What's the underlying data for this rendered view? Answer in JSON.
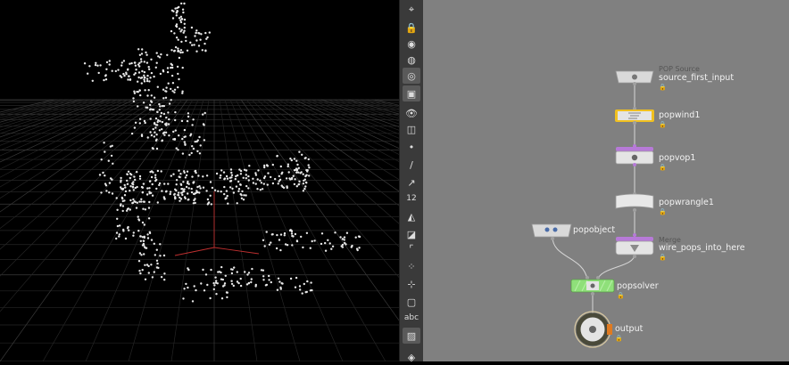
{
  "toolbar": {
    "tools": [
      {
        "name": "select-icon",
        "glyph": "⌖"
      },
      {
        "name": "lock-icon",
        "glyph": "🔒"
      },
      {
        "name": "camera-icon",
        "glyph": "◉"
      },
      {
        "name": "sphere-icon",
        "glyph": "◍"
      },
      {
        "name": "light-icon",
        "glyph": "◎"
      },
      {
        "name": "render-icon",
        "glyph": "▣"
      },
      {
        "name": "visibility-icon",
        "glyph": "👁"
      },
      {
        "name": "display-icon",
        "glyph": "◫"
      },
      {
        "name": "point-icon",
        "glyph": "•"
      },
      {
        "name": "edge-icon",
        "glyph": "/"
      },
      {
        "name": "vector-icon",
        "glyph": "↗"
      },
      {
        "name": "numbers-icon",
        "glyph": "12"
      },
      {
        "name": "paint-icon",
        "glyph": "◭"
      },
      {
        "name": "shaded-icon",
        "glyph": "◪"
      },
      {
        "name": "corner-icon",
        "glyph": "⌜"
      },
      {
        "name": "grid-points-icon",
        "glyph": "⁘"
      },
      {
        "name": "scatter-icon",
        "glyph": "⊹"
      },
      {
        "name": "box-icon",
        "glyph": "▢"
      },
      {
        "name": "text-icon",
        "glyph": "abc"
      },
      {
        "name": "image-icon",
        "glyph": "▨"
      },
      {
        "name": "pin-icon",
        "glyph": "◈"
      }
    ]
  },
  "network": {
    "nodes": {
      "source": {
        "type": "POP Source",
        "name": "source_first_input"
      },
      "popwind": {
        "name": "popwind1"
      },
      "popvop": {
        "name": "popvop1"
      },
      "popwrangle": {
        "name": "popwrangle1"
      },
      "merge": {
        "type": "Merge",
        "name": "wire_pops_into_here"
      },
      "popobject": {
        "name": "popobject"
      },
      "popsolver": {
        "name": "popsolver"
      },
      "output": {
        "name": "output"
      }
    },
    "lock_glyph": "🔒"
  },
  "colors": {
    "network_bg": "#808080",
    "wire": "#d8d8d8",
    "selected": "#f0c020",
    "solver": "#8fe07a",
    "vop": "#b77ad8",
    "output_ring": "#4a4a3a",
    "output_flag": "#e07a20",
    "viewport_bg": "#000000",
    "axis_red": "#c03030"
  }
}
